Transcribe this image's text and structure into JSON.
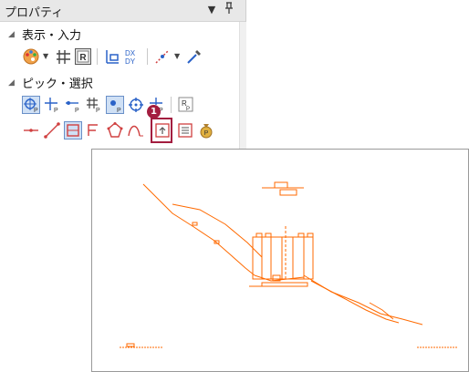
{
  "panel": {
    "title": "プロパティ",
    "title_dropdown_icon": "dropdown-triangle-icon",
    "pin_icon": "pin-icon"
  },
  "sections": [
    {
      "label": "表示・入力",
      "expanded": true
    },
    {
      "label": "ピック・選択",
      "expanded": true
    }
  ],
  "highlight": {
    "badge": "1",
    "color": "#a31d3f"
  },
  "drawing": {
    "line_color": "#ff6a00"
  }
}
